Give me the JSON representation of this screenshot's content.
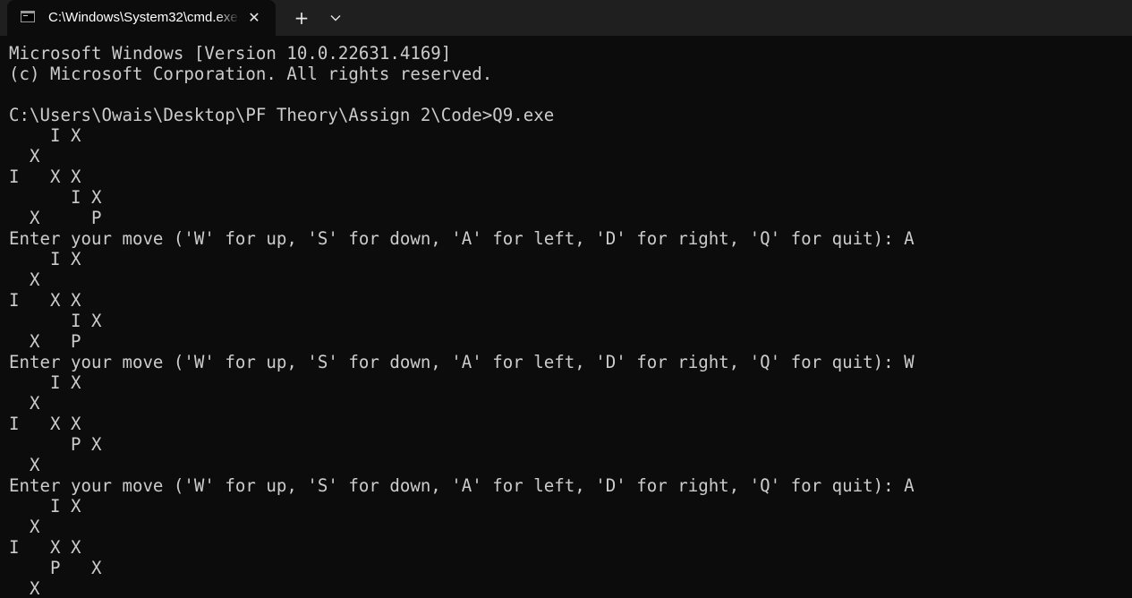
{
  "window": {
    "tab_title": "C:\\Windows\\System32\\cmd.exe",
    "icons": {
      "tab": "console-icon",
      "close": "close-icon",
      "new_tab": "plus-icon",
      "dropdown": "chevron-down-icon"
    },
    "close_glyph": "✕",
    "new_tab_glyph": "+"
  },
  "colors": {
    "background": "#0c0c0c",
    "tabbar": "#1f1f1f",
    "text": "#cccccc"
  },
  "console": {
    "lines": [
      "Microsoft Windows [Version 10.0.22631.4169]",
      "(c) Microsoft Corporation. All rights reserved.",
      "",
      "C:\\Users\\Owais\\Desktop\\PF Theory\\Assign 2\\Code>Q9.exe",
      "    I X",
      "  X",
      "I   X X",
      "      I X",
      "  X     P",
      "Enter your move ('W' for up, 'S' for down, 'A' for left, 'D' for right, 'Q' for quit): A",
      "    I X",
      "  X",
      "I   X X",
      "      I X",
      "  X   P",
      "Enter your move ('W' for up, 'S' for down, 'A' for left, 'D' for right, 'Q' for quit): W",
      "    I X",
      "  X",
      "I   X X",
      "      P X",
      "  X",
      "Enter your move ('W' for up, 'S' for down, 'A' for left, 'D' for right, 'Q' for quit): A",
      "    I X",
      "  X",
      "I   X X",
      "    P   X",
      "  X"
    ]
  }
}
